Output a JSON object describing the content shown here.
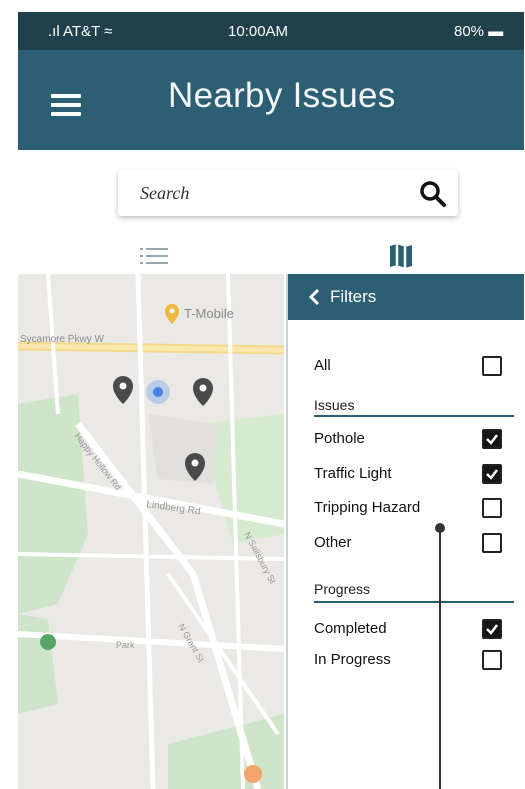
{
  "status": {
    "carrier": ".ıl AT&T ≈",
    "time": "10:00AM",
    "battery": "80% ▬"
  },
  "header": {
    "title": "Nearby Issues",
    "menu_icon": "hamburger-icon"
  },
  "search": {
    "placeholder": "Search",
    "icon": "search-icon"
  },
  "view_toggle": {
    "list_icon": "list-icon",
    "map_icon": "map-icon",
    "active": "map"
  },
  "map": {
    "labels": {
      "poi": "T-Mobile",
      "street_top": "Sycamore Pkwy W",
      "street_mid": "Lindberg Rd",
      "street_diag": "N Salisbury St",
      "street_low": "N Grant St",
      "street_left": "Happy Hollow Rd",
      "park": "Park"
    },
    "pins": 3
  },
  "filters": {
    "back_label": "Filters",
    "all": {
      "label": "All",
      "checked": false
    },
    "issues_heading": "Issues",
    "issues": [
      {
        "label": "Pothole",
        "checked": true
      },
      {
        "label": "Traffic Light",
        "checked": true
      },
      {
        "label": "Tripping Hazard",
        "checked": false
      },
      {
        "label": "Other",
        "checked": false
      }
    ],
    "progress_heading": "Progress",
    "progress": [
      {
        "label": "Completed",
        "checked": true
      },
      {
        "label": "In Progress",
        "checked": false
      }
    ]
  },
  "colors": {
    "header": "#2d5f74",
    "status_bar": "#20404b",
    "pin": "#4a4a4a"
  }
}
